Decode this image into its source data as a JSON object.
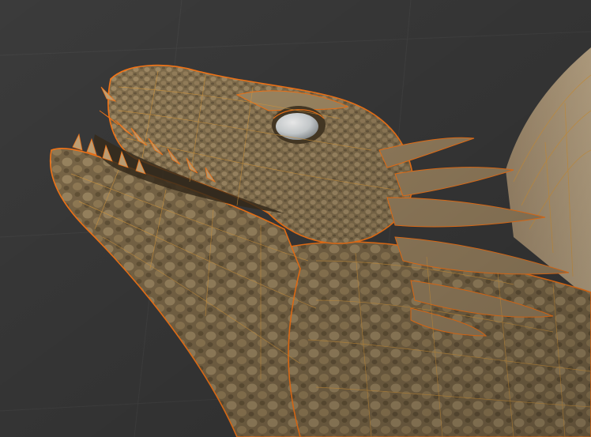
{
  "viewport": {
    "mode": "3d-sculpt-viewport",
    "background_color": "#3b3b3b",
    "grid_color": "#464646",
    "subject": "dragon-head-model"
  },
  "model": {
    "skin_color": "#8a7757",
    "skin_light_color": "#b9a27c",
    "skin_dark_color": "#5a4a33",
    "wire_color": "#e0a040",
    "selection_outline_color": "#ff7a18",
    "eye_color": "#e8ecee"
  }
}
